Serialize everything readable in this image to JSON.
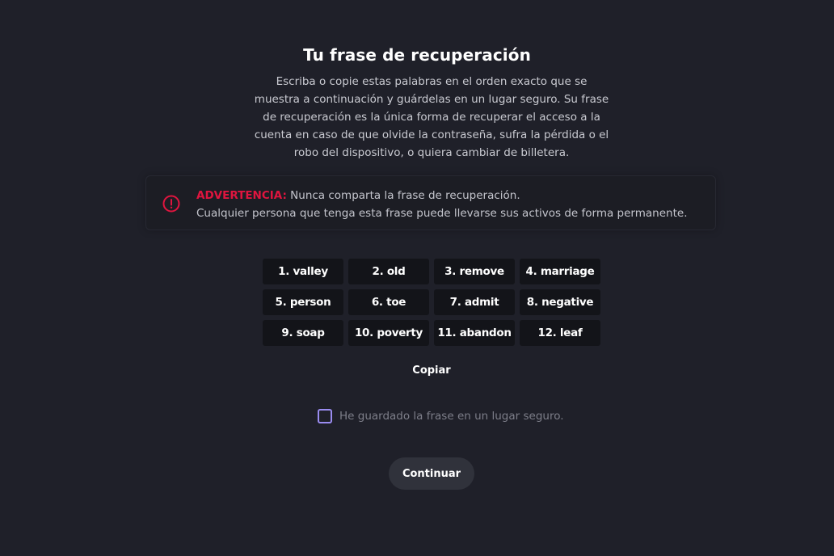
{
  "title": "Tu frase de recuperación",
  "description_lines": [
    "Escriba o copie estas palabras en el orden exacto que se",
    "muestra a continuación y guárdelas en un lugar seguro. Su frase",
    "de recuperación es la única forma de recuperar el acceso a la",
    "cuenta en caso de que olvide la contraseña, sufra la pérdida o el",
    "robo del dispositivo, o quiera cambiar de billetera."
  ],
  "warning": {
    "label": "ADVERTENCIA:",
    "line1": "Nunca comparta la frase de recuperación.",
    "line2": "Cualquier persona que tenga esta frase puede llevarse sus activos de forma permanente.",
    "icon": "alert-circle-icon",
    "color": "#e0153f"
  },
  "words": [
    "1. valley",
    "2. old",
    "3. remove",
    "4. marriage",
    "5. person",
    "6. toe",
    "7. admit",
    "8. negative",
    "9. soap",
    "10. poverty",
    "11. abandon",
    "12. leaf"
  ],
  "copy_label": "Copiar",
  "checkbox": {
    "label": "He guardado la frase en un lugar seguro.",
    "checked": false,
    "color": "#9a8cf0"
  },
  "continue_label": "Continuar"
}
